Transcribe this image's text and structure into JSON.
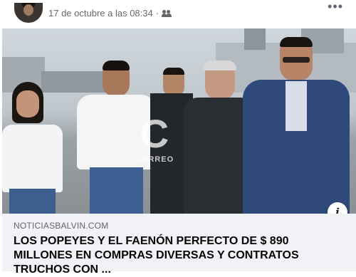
{
  "post": {
    "timestamp": "17 de octubre a las 08:34",
    "separator": "·",
    "audience_icon": "friends-icon",
    "more_label": "•••"
  },
  "photo": {
    "watermark_letter": "C",
    "watermark_text": "CORREO"
  },
  "link": {
    "domain": "NOTICIASBALVIN.COM",
    "headline": "LOS POPEYES Y EL FAENÓN PERFECTO DE $ 890 MILLONES EN COMPRAS DIVERSAS Y CONTRATOS TRUCHOS CON ...",
    "info_label": "i"
  }
}
